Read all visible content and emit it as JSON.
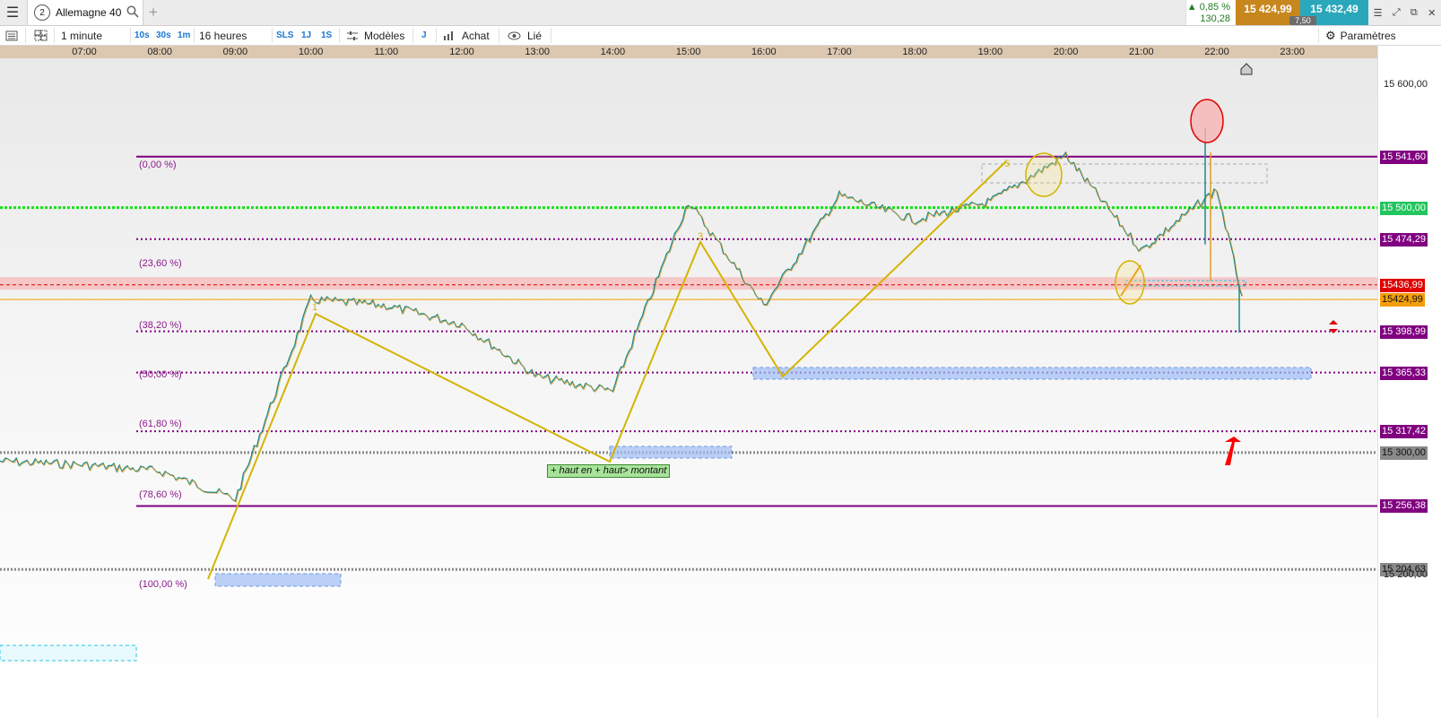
{
  "tabbar": {
    "tab_number": "2",
    "instrument": "Allemagne 40",
    "change_pct": "0,85 %",
    "change_pts": "130,28",
    "bid": "15 424,99",
    "ask": "15 432,49",
    "spread": "7,50"
  },
  "toolbar": {
    "interval": "1 minute",
    "tf_10s": "10s",
    "tf_30s": "30s",
    "tf_1m": "1m",
    "range": "16 heures",
    "sls": "SLS",
    "r_1j": "1J",
    "r_1s": "1S",
    "models": "Modèles",
    "j": "J",
    "buy": "Achat",
    "linked": "Lié",
    "settings": "Paramètres"
  },
  "time_axis": [
    "07:00",
    "08:00",
    "09:00",
    "10:00",
    "11:00",
    "12:00",
    "13:00",
    "14:00",
    "15:00",
    "16:00",
    "17:00",
    "18:00",
    "19:00",
    "20:00",
    "21:00",
    "22:00",
    "23:00"
  ],
  "fib_labels": [
    "(0,00 %)",
    "(23,60 %)",
    "(38,20 %)",
    "(50,00 %)",
    "(61,80 %)",
    "(78,60 %)",
    "(100,00 %)"
  ],
  "price_labels": [
    {
      "text": "15 600,00",
      "style": "plain"
    },
    {
      "text": "15 541,60",
      "style": "purple"
    },
    {
      "text": "15 500,00",
      "style": "green"
    },
    {
      "text": "15 474,29",
      "style": "purple"
    },
    {
      "text": "15436,99",
      "style": "red"
    },
    {
      "text": "15424,99",
      "style": "orange"
    },
    {
      "text": "15 398,99",
      "style": "purple"
    },
    {
      "text": "15 365,33",
      "style": "purple"
    },
    {
      "text": "15 317,42",
      "style": "purple"
    },
    {
      "text": "15 300,00",
      "style": "gray"
    },
    {
      "text": "15 256,38",
      "style": "purple"
    },
    {
      "text": "15 204,63",
      "style": "gray"
    },
    {
      "text": "15 200,00",
      "style": "plain"
    }
  ],
  "wave_labels": [
    "1",
    "3",
    "5"
  ],
  "annotation": "+ haut en + haut> montant",
  "colors": {
    "purple": "#800080",
    "green": "#22c55e",
    "red": "#e00000",
    "orange": "#f59e0b",
    "gray": "#8a8a8a",
    "wave": "#d4b400",
    "bid": "#c7861e",
    "ask": "#2aa7bb"
  },
  "chart_data": {
    "type": "line",
    "instrument": "Allemagne 40",
    "x": [
      "07:00",
      "08:00",
      "09:00",
      "10:00",
      "11:00",
      "12:00",
      "13:00",
      "14:00",
      "15:00",
      "16:00",
      "17:00",
      "18:00",
      "19:00",
      "20:00",
      "21:00",
      "22:00",
      "22:20"
    ],
    "series": [
      {
        "values": [
          15290,
          15285,
          15262,
          15425,
          15420,
          15405,
          15362,
          15350,
          15505,
          15420,
          15510,
          15490,
          15505,
          15543,
          15465,
          15515,
          15428
        ]
      }
    ],
    "ylim": [
      15200,
      15620
    ],
    "horizontal_levels": [
      15541.6,
      15500.0,
      15474.29,
      15436.99,
      15424.99,
      15398.99,
      15365.33,
      15317.42,
      15300.0,
      15256.38,
      15204.63
    ]
  }
}
